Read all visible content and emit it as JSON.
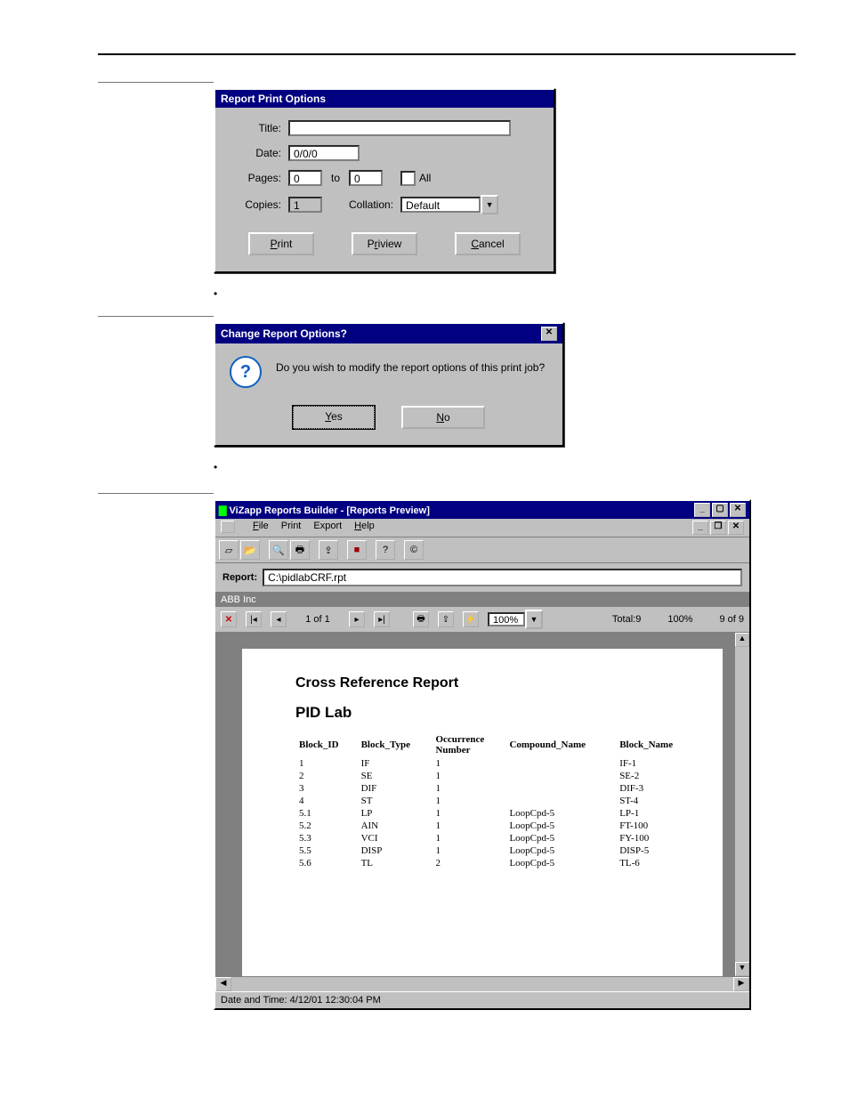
{
  "printDlg": {
    "title": "Report Print Options",
    "labels": {
      "title": "Title:",
      "date": "Date:",
      "pages": "Pages:",
      "to": "to",
      "all": "All",
      "copies": "Copies:",
      "collation": "Collation:"
    },
    "values": {
      "title": "",
      "date": "0/0/0",
      "pageFrom": "0",
      "pageTo": "0",
      "copies": "1",
      "collation": "Default"
    },
    "buttons": {
      "print": "Print",
      "preview": "Priview",
      "cancel": "Cancel"
    }
  },
  "bullets": {
    "b1": "",
    "b2": ""
  },
  "changeDlg": {
    "title": "Change Report Options?",
    "msg": "Do you wish to modify the report options of this print job?",
    "yes": "Yes",
    "no": "No"
  },
  "app": {
    "title": "ViZapp Reports Builder - [Reports Preview]",
    "menu": {
      "file": "File",
      "print": "Print",
      "export": "Export",
      "help": "Help"
    },
    "reportLabel": "Report:",
    "reportPath": "C:\\pidlabCRF.rpt",
    "company": "ABB Inc",
    "nav": {
      "page": "1 of 1",
      "zoom": "100%",
      "total": "Total:9",
      "pct": "100%",
      "count": "9 of 9"
    },
    "status": "Date and Time: 4/12/01 12:30:04 PM"
  },
  "report": {
    "heading": "Cross Reference Report",
    "sub": "PID Lab",
    "cols": {
      "c1": "Block_ID",
      "c2": "Block_Type",
      "c3": "Occurrence Number",
      "c4": "Compound_Name",
      "c5": "Block_Name"
    },
    "rows": [
      {
        "id": "1",
        "type": "IF",
        "occ": "1",
        "comp": "",
        "name": "IF-1"
      },
      {
        "id": "2",
        "type": "SE",
        "occ": "1",
        "comp": "",
        "name": "SE-2"
      },
      {
        "id": "3",
        "type": "DIF",
        "occ": "1",
        "comp": "",
        "name": "DIF-3"
      },
      {
        "id": "4",
        "type": "ST",
        "occ": "1",
        "comp": "",
        "name": "ST-4"
      },
      {
        "id": "5.1",
        "type": "LP",
        "occ": "1",
        "comp": "LoopCpd-5",
        "name": "LP-1"
      },
      {
        "id": "5.2",
        "type": "AIN",
        "occ": "1",
        "comp": "LoopCpd-5",
        "name": "FT-100"
      },
      {
        "id": "5.3",
        "type": "VCI",
        "occ": "1",
        "comp": "LoopCpd-5",
        "name": "FY-100"
      },
      {
        "id": "5.5",
        "type": "DISP",
        "occ": "1",
        "comp": "LoopCpd-5",
        "name": "DISP-5"
      },
      {
        "id": "5.6",
        "type": "TL",
        "occ": "2",
        "comp": "LoopCpd-5",
        "name": "TL-6"
      }
    ]
  }
}
